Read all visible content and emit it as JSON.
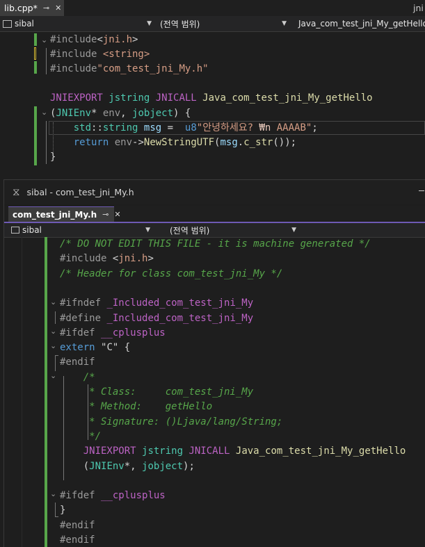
{
  "editor1": {
    "tab_title": "lib.cpp*",
    "tab_pin": "⊸",
    "tab_close": "✕",
    "right_tab_fragment": "jni",
    "project_combo": "sibal",
    "scope_combo": "(전역 범위)",
    "function_combo": "Java_com_test_jni_My_getHello(",
    "lines": [
      {
        "tokens": [
          {
            "t": "#include",
            "c": "pp"
          },
          {
            "t": "<",
            "c": "pl"
          },
          {
            "t": "jni.h",
            "c": "str"
          },
          {
            "t": ">",
            "c": "pl"
          }
        ]
      },
      {
        "tokens": [
          {
            "t": "#include ",
            "c": "pp"
          },
          {
            "t": "<string>",
            "c": "str"
          }
        ]
      },
      {
        "tokens": [
          {
            "t": "#include",
            "c": "pp"
          },
          {
            "t": "\"com_test_jni_My.h\"",
            "c": "str"
          }
        ]
      },
      {
        "tokens": []
      },
      {
        "tokens": [
          {
            "t": "JNIEXPORT ",
            "c": "mac"
          },
          {
            "t": "jstring ",
            "c": "ty"
          },
          {
            "t": "JNICALL ",
            "c": "mac"
          },
          {
            "t": "Java_com_test_jni_My_getHello",
            "c": "fn"
          }
        ]
      },
      {
        "tokens": [
          {
            "t": "(",
            "c": "pl"
          },
          {
            "t": "JNIEnv",
            "c": "ty"
          },
          {
            "t": "* ",
            "c": "pl"
          },
          {
            "t": "env",
            "c": "prm"
          },
          {
            "t": ", ",
            "c": "pl"
          },
          {
            "t": "jobject",
            "c": "ty"
          },
          {
            "t": ") {",
            "c": "pl"
          }
        ]
      },
      {
        "tokens": [
          {
            "t": "    std",
            "c": "ty"
          },
          {
            "t": "::",
            "c": "pl"
          },
          {
            "t": "string ",
            "c": "ty"
          },
          {
            "t": "msg",
            "c": "var"
          },
          {
            "t": " =  ",
            "c": "pl"
          },
          {
            "t": "u8",
            "c": "kw"
          },
          {
            "t": "\"안녕하세요? ",
            "c": "str"
          },
          {
            "t": "₩n",
            "c": "esc"
          },
          {
            "t": " AAAAB\"",
            "c": "str"
          },
          {
            "t": ";",
            "c": "pl"
          }
        ]
      },
      {
        "tokens": [
          {
            "t": "    ",
            "c": "pl"
          },
          {
            "t": "return ",
            "c": "kw"
          },
          {
            "t": "env",
            "c": "prm"
          },
          {
            "t": "->",
            "c": "pl"
          },
          {
            "t": "NewStringUTF",
            "c": "fn"
          },
          {
            "t": "(",
            "c": "pl"
          },
          {
            "t": "msg",
            "c": "var"
          },
          {
            "t": ".",
            "c": "pl"
          },
          {
            "t": "c_str",
            "c": "fn"
          },
          {
            "t": "());",
            "c": "pl"
          }
        ]
      },
      {
        "tokens": [
          {
            "t": "}",
            "c": "pl"
          }
        ]
      }
    ]
  },
  "editor2": {
    "window_title": "sibal - com_test_jni_My.h",
    "tab_title": "com_test_jni_My.h",
    "tab_pin": "⊸",
    "tab_close": "✕",
    "project_combo": "sibal",
    "scope_combo": "(전역 범위)",
    "lines": [
      {
        "tokens": [
          {
            "t": "/* DO NOT EDIT THIS FILE - it is machine generated */",
            "c": "cm"
          }
        ]
      },
      {
        "tokens": [
          {
            "t": "#include ",
            "c": "pp"
          },
          {
            "t": "<",
            "c": "pl"
          },
          {
            "t": "jni.h",
            "c": "str"
          },
          {
            "t": ">",
            "c": "pl"
          }
        ]
      },
      {
        "tokens": [
          {
            "t": "/* Header for class com_test_jni_My */",
            "c": "cm"
          }
        ]
      },
      {
        "tokens": []
      },
      {
        "tokens": [
          {
            "t": "#ifndef ",
            "c": "pp"
          },
          {
            "t": "_Included_com_test_jni_My",
            "c": "mac"
          }
        ]
      },
      {
        "tokens": [
          {
            "t": "#define ",
            "c": "pp"
          },
          {
            "t": "_Included_com_test_jni_My",
            "c": "mac"
          }
        ]
      },
      {
        "tokens": [
          {
            "t": "#ifdef ",
            "c": "pp"
          },
          {
            "t": "__cplusplus",
            "c": "mac"
          }
        ]
      },
      {
        "tokens": [
          {
            "t": "extern ",
            "c": "kw"
          },
          {
            "t": "\"C\" {",
            "c": "pl"
          }
        ]
      },
      {
        "tokens": [
          {
            "t": "#endif",
            "c": "pp"
          }
        ]
      },
      {
        "tokens": [
          {
            "t": "    /*",
            "c": "cm"
          }
        ]
      },
      {
        "tokens": [
          {
            "t": "     * Class:     com_test_jni_My",
            "c": "cm"
          }
        ]
      },
      {
        "tokens": [
          {
            "t": "     * Method:    getHello",
            "c": "cm"
          }
        ]
      },
      {
        "tokens": [
          {
            "t": "     * Signature: ()Ljava/lang/String;",
            "c": "cm"
          }
        ]
      },
      {
        "tokens": [
          {
            "t": "     */",
            "c": "cm"
          }
        ]
      },
      {
        "tokens": [
          {
            "t": "    JNIEXPORT ",
            "c": "mac"
          },
          {
            "t": "jstring ",
            "c": "ty"
          },
          {
            "t": "JNICALL ",
            "c": "mac"
          },
          {
            "t": "Java_com_test_jni_My_getHello",
            "c": "fn"
          }
        ]
      },
      {
        "tokens": [
          {
            "t": "    (",
            "c": "pl"
          },
          {
            "t": "JNIEnv",
            "c": "ty"
          },
          {
            "t": "*, ",
            "c": "pl"
          },
          {
            "t": "jobject",
            "c": "ty"
          },
          {
            "t": ");",
            "c": "pl"
          }
        ]
      },
      {
        "tokens": []
      },
      {
        "tokens": [
          {
            "t": "#ifdef ",
            "c": "pp"
          },
          {
            "t": "__cplusplus",
            "c": "mac"
          }
        ]
      },
      {
        "tokens": [
          {
            "t": "}",
            "c": "pl"
          }
        ]
      },
      {
        "tokens": [
          {
            "t": "#endif",
            "c": "pp"
          }
        ]
      },
      {
        "tokens": [
          {
            "t": "#endif",
            "c": "pp"
          }
        ]
      }
    ]
  }
}
